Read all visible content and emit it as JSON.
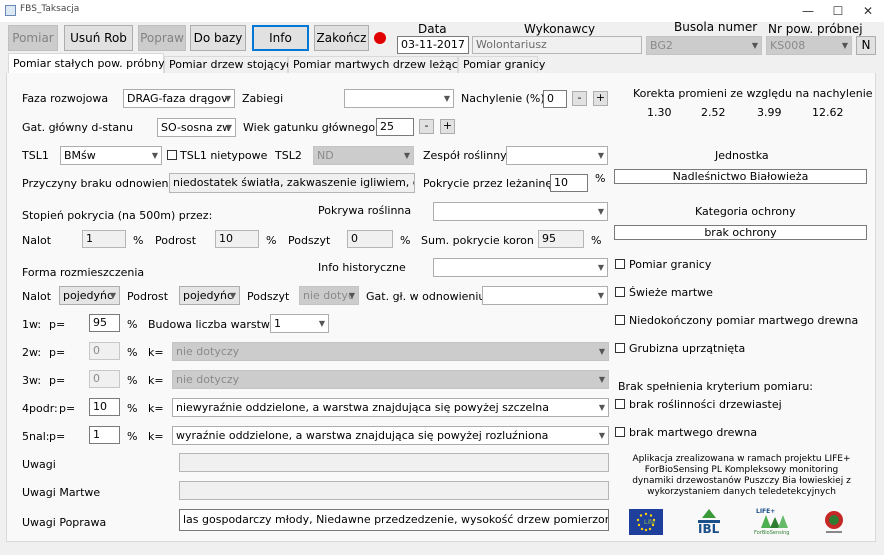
{
  "window": {
    "title": "FBS_Taksacja",
    "min": "—",
    "max": "☐",
    "close": "✕"
  },
  "toolbar": {
    "pomiar": "Pomiar",
    "usun": "Usuń Rob",
    "popraw": "Popraw",
    "do_bazy": "Do bazy",
    "info": "Info",
    "zakoncz": "Zakończ"
  },
  "header": {
    "data_label": "Data",
    "data_value": "03-11-2017",
    "wykonawcy_label": "Wykonawcy",
    "wykonawcy_value": "Wolontariusz",
    "busola_label": "Busola numer",
    "busola_value": "BG2",
    "nr_pow_label": "Nr pow. próbnej",
    "nr_pow_value": "KS008",
    "n_button": "N"
  },
  "tabs": [
    "Pomiar stałych pow. próbnych",
    "Pomiar drzew stojących",
    "Pomiar martwych drzew leżących",
    "Pomiar granicy"
  ],
  "form": {
    "faza_label": "Faza rozwojowa",
    "faza_value": "DRAG-faza drągov",
    "zabiegi_label": "Zabiegi",
    "zabiegi_value": "",
    "nachylenie_label": "Nachylenie (%)",
    "nachylenie_value": "0",
    "gat_label": "Gat. główny d-stanu",
    "gat_value": "SO-sosna zw",
    "wiek_label": "Wiek gatunku głównego",
    "wiek_value": "25",
    "tsl1_label": "TSL1",
    "tsl1_value": "BMśw",
    "tsl1_nietypowe": "TSL1 nietypowe",
    "tsl2_label": "TSL2",
    "tsl2_value": "ND",
    "zespol_label": "Zespół roślinny",
    "zespol_value": "",
    "przyczyny_label": "Przyczyny braku odnowienia",
    "przyczyny_value": "niedostatek światła, zakwaszenie igliwiem, gruba",
    "pokrycie_lez_label": "Pokrycie przez leżaninę",
    "pokrycie_lez_value": "10",
    "pct": "%",
    "stopien_label": "Stopień pokrycia (na 500m) przez:",
    "pokrywa_label": "Pokrywa roślinna",
    "pokrywa_value": "",
    "nalot_label": "Nalot",
    "nalot_value": "1",
    "podrost_label": "Podrost",
    "podrost_value": "10",
    "podszyt_label": "Podszyt",
    "podszyt_value": "0",
    "suma_label": "Sum. pokrycie koron",
    "suma_value": "95",
    "forma_label": "Forma rozmieszczenia",
    "info_hist_label": "Info historyczne",
    "info_hist_value": "",
    "nalot2_label": "Nalot",
    "nalot2_value": "pojedyńc",
    "podrost2_label": "Podrost",
    "podrost2_value": "pojedyńc",
    "podszyt2_label": "Podszyt",
    "podszyt2_value": "nie dotyc",
    "gatodn_label": "Gat. gł. w odnowieniu",
    "gatodn_value": "",
    "w1_label": "1w:",
    "w1_p": "p=",
    "w1_value": "95",
    "budowa_label": "Budowa liczba warstw",
    "budowa_value": "1",
    "w2_label": "2w:",
    "w2_p": "p=",
    "w2_value": "0",
    "w2_k": "k=",
    "w2_kvalue": "nie dotyczy",
    "w3_label": "3w:",
    "w3_p": "p=",
    "w3_value": "0",
    "w3_k": "k=",
    "w3_kvalue": "nie dotyczy",
    "w4_label": "4podr:",
    "w4_p": "p=",
    "w4_value": "10",
    "w4_k": "k=",
    "w4_kvalue": "niewyraźnie oddzielone, a warstwa znajdująca się powyżej szczelna",
    "w5_label": "5nal:",
    "w5_p": "p=",
    "w5_value": "1",
    "w5_k": "k=",
    "w5_kvalue": "wyraźnie oddzielone, a warstwa znajdująca się powyżej rozluźniona",
    "uwagi_label": "Uwagi",
    "uwagi_value": "",
    "uwagi_martwe_label": "Uwagi Martwe",
    "uwagi_martwe_value": "",
    "uwagi_poprawa_label": "Uwagi Poprawa",
    "uwagi_poprawa_value": "las gospodarczy młody, Niedawne przedzedzenie, wysokość drzew pomierzono do azymu"
  },
  "right": {
    "korekta_label": "Korekta promieni ze względu na nachylenie",
    "korekta_values": [
      "1.30",
      "2.52",
      "3.99",
      "12.62"
    ],
    "jednostka_label": "Jednostka",
    "jednostka_value": "Nadleśnictwo Białowieża",
    "kategoria_label": "Kategoria ochrony",
    "kategoria_value": "brak ochrony",
    "chk_granicy": "Pomiar granicy",
    "chk_swieze": "Świeże martwe",
    "chk_niedok": "Niedokończony pomiar martwego drewna",
    "chk_grubizna": "Grubizna uprzątnięta",
    "brak_label": "Brak spełnienia kryterium pomiaru:",
    "chk_brak_rosl": "brak roślinności drzewiastej",
    "chk_brak_martw": "brak martwego drewna",
    "footer": [
      "Aplikacja zrealizowana w ramach projektu LIFE+",
      "ForBioSensing PL Kompleksowy monitoring",
      "dynamiki drzewostanów Puszczy Bia łowieskiej z",
      "wykorzystaniem danych teledetekcyjnych"
    ],
    "logo_ibl": "IBL",
    "logo_life": "LIFE+",
    "logo_life_sub": "ForBioSensing"
  },
  "colors": {
    "accent": "#0078d7",
    "red": "#e00000",
    "eu_blue": "#1e3f9c"
  }
}
